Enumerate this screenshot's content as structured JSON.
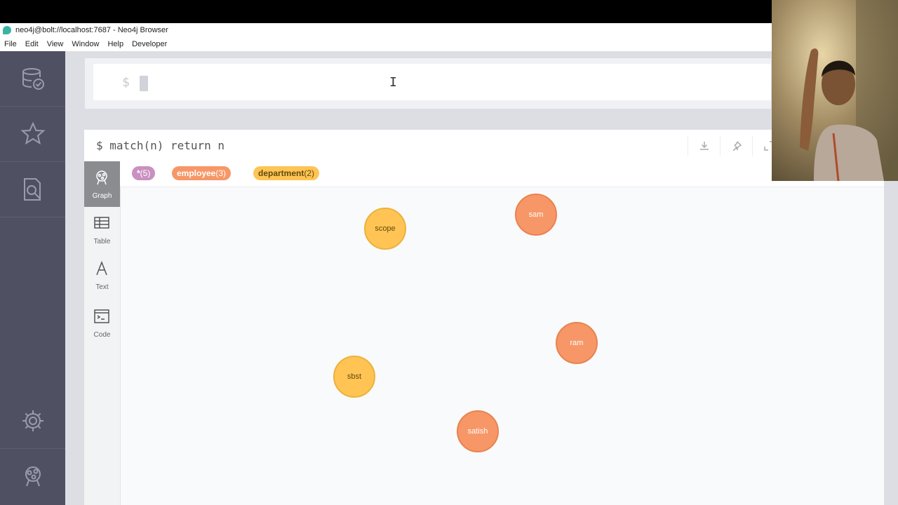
{
  "window": {
    "title": "neo4j@bolt://localhost:7687 - Neo4j Browser"
  },
  "menu": [
    "File",
    "Edit",
    "View",
    "Window",
    "Help",
    "Developer"
  ],
  "sidebar_icons": [
    "database-icon",
    "star-icon",
    "search-document-icon",
    "gear-icon",
    "neo4j-logo-icon"
  ],
  "editor": {
    "prompt": "$"
  },
  "frame": {
    "query_prompt": "$",
    "query": "match(n) return n",
    "tabs": [
      {
        "label": "Graph",
        "active": true,
        "icon": "graph-icon"
      },
      {
        "label": "Table",
        "active": false,
        "icon": "table-icon"
      },
      {
        "label": "Text",
        "active": false,
        "icon": "text-icon"
      },
      {
        "label": "Code",
        "active": false,
        "icon": "code-icon"
      }
    ],
    "badges": [
      {
        "label": "*",
        "count": "(5)",
        "color": "#c990c0"
      },
      {
        "label": "employee",
        "count": "(3)",
        "color": "#f79767"
      },
      {
        "label": "department",
        "count": "(2)",
        "color": "#ffc454"
      }
    ]
  },
  "graph": {
    "nodes": [
      {
        "label": "scope",
        "type": "department"
      },
      {
        "label": "sam",
        "type": "employee"
      },
      {
        "label": "ram",
        "type": "employee"
      },
      {
        "label": "sbst",
        "type": "department"
      },
      {
        "label": "satish",
        "type": "employee"
      }
    ]
  },
  "colors": {
    "employee": "#f79767",
    "department": "#ffc454",
    "all": "#c990c0",
    "sidebar": "#4f5163"
  }
}
